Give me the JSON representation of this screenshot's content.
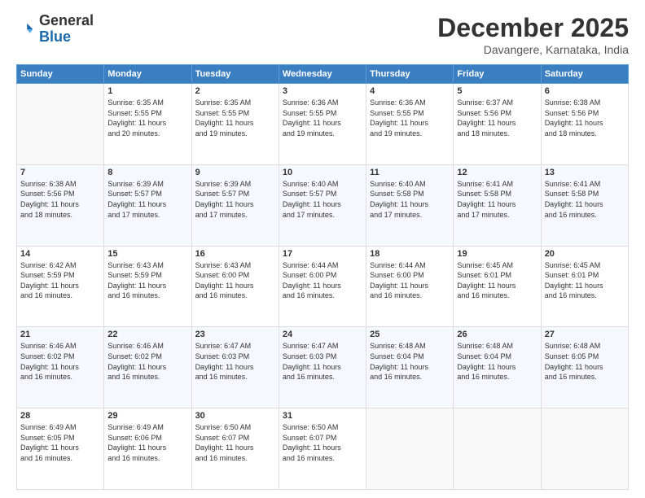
{
  "header": {
    "logo_general": "General",
    "logo_blue": "Blue",
    "month": "December 2025",
    "location": "Davangere, Karnataka, India"
  },
  "days_of_week": [
    "Sunday",
    "Monday",
    "Tuesday",
    "Wednesday",
    "Thursday",
    "Friday",
    "Saturday"
  ],
  "weeks": [
    [
      {
        "day": "",
        "content": ""
      },
      {
        "day": "1",
        "content": "Sunrise: 6:35 AM\nSunset: 5:55 PM\nDaylight: 11 hours\nand 20 minutes."
      },
      {
        "day": "2",
        "content": "Sunrise: 6:35 AM\nSunset: 5:55 PM\nDaylight: 11 hours\nand 19 minutes."
      },
      {
        "day": "3",
        "content": "Sunrise: 6:36 AM\nSunset: 5:55 PM\nDaylight: 11 hours\nand 19 minutes."
      },
      {
        "day": "4",
        "content": "Sunrise: 6:36 AM\nSunset: 5:55 PM\nDaylight: 11 hours\nand 19 minutes."
      },
      {
        "day": "5",
        "content": "Sunrise: 6:37 AM\nSunset: 5:56 PM\nDaylight: 11 hours\nand 18 minutes."
      },
      {
        "day": "6",
        "content": "Sunrise: 6:38 AM\nSunset: 5:56 PM\nDaylight: 11 hours\nand 18 minutes."
      }
    ],
    [
      {
        "day": "7",
        "content": "Sunrise: 6:38 AM\nSunset: 5:56 PM\nDaylight: 11 hours\nand 18 minutes."
      },
      {
        "day": "8",
        "content": "Sunrise: 6:39 AM\nSunset: 5:57 PM\nDaylight: 11 hours\nand 17 minutes."
      },
      {
        "day": "9",
        "content": "Sunrise: 6:39 AM\nSunset: 5:57 PM\nDaylight: 11 hours\nand 17 minutes."
      },
      {
        "day": "10",
        "content": "Sunrise: 6:40 AM\nSunset: 5:57 PM\nDaylight: 11 hours\nand 17 minutes."
      },
      {
        "day": "11",
        "content": "Sunrise: 6:40 AM\nSunset: 5:58 PM\nDaylight: 11 hours\nand 17 minutes."
      },
      {
        "day": "12",
        "content": "Sunrise: 6:41 AM\nSunset: 5:58 PM\nDaylight: 11 hours\nand 17 minutes."
      },
      {
        "day": "13",
        "content": "Sunrise: 6:41 AM\nSunset: 5:58 PM\nDaylight: 11 hours\nand 16 minutes."
      }
    ],
    [
      {
        "day": "14",
        "content": "Sunrise: 6:42 AM\nSunset: 5:59 PM\nDaylight: 11 hours\nand 16 minutes."
      },
      {
        "day": "15",
        "content": "Sunrise: 6:43 AM\nSunset: 5:59 PM\nDaylight: 11 hours\nand 16 minutes."
      },
      {
        "day": "16",
        "content": "Sunrise: 6:43 AM\nSunset: 6:00 PM\nDaylight: 11 hours\nand 16 minutes."
      },
      {
        "day": "17",
        "content": "Sunrise: 6:44 AM\nSunset: 6:00 PM\nDaylight: 11 hours\nand 16 minutes."
      },
      {
        "day": "18",
        "content": "Sunrise: 6:44 AM\nSunset: 6:00 PM\nDaylight: 11 hours\nand 16 minutes."
      },
      {
        "day": "19",
        "content": "Sunrise: 6:45 AM\nSunset: 6:01 PM\nDaylight: 11 hours\nand 16 minutes."
      },
      {
        "day": "20",
        "content": "Sunrise: 6:45 AM\nSunset: 6:01 PM\nDaylight: 11 hours\nand 16 minutes."
      }
    ],
    [
      {
        "day": "21",
        "content": "Sunrise: 6:46 AM\nSunset: 6:02 PM\nDaylight: 11 hours\nand 16 minutes."
      },
      {
        "day": "22",
        "content": "Sunrise: 6:46 AM\nSunset: 6:02 PM\nDaylight: 11 hours\nand 16 minutes."
      },
      {
        "day": "23",
        "content": "Sunrise: 6:47 AM\nSunset: 6:03 PM\nDaylight: 11 hours\nand 16 minutes."
      },
      {
        "day": "24",
        "content": "Sunrise: 6:47 AM\nSunset: 6:03 PM\nDaylight: 11 hours\nand 16 minutes."
      },
      {
        "day": "25",
        "content": "Sunrise: 6:48 AM\nSunset: 6:04 PM\nDaylight: 11 hours\nand 16 minutes."
      },
      {
        "day": "26",
        "content": "Sunrise: 6:48 AM\nSunset: 6:04 PM\nDaylight: 11 hours\nand 16 minutes."
      },
      {
        "day": "27",
        "content": "Sunrise: 6:48 AM\nSunset: 6:05 PM\nDaylight: 11 hours\nand 16 minutes."
      }
    ],
    [
      {
        "day": "28",
        "content": "Sunrise: 6:49 AM\nSunset: 6:05 PM\nDaylight: 11 hours\nand 16 minutes."
      },
      {
        "day": "29",
        "content": "Sunrise: 6:49 AM\nSunset: 6:06 PM\nDaylight: 11 hours\nand 16 minutes."
      },
      {
        "day": "30",
        "content": "Sunrise: 6:50 AM\nSunset: 6:07 PM\nDaylight: 11 hours\nand 16 minutes."
      },
      {
        "day": "31",
        "content": "Sunrise: 6:50 AM\nSunset: 6:07 PM\nDaylight: 11 hours\nand 16 minutes."
      },
      {
        "day": "",
        "content": ""
      },
      {
        "day": "",
        "content": ""
      },
      {
        "day": "",
        "content": ""
      }
    ]
  ]
}
